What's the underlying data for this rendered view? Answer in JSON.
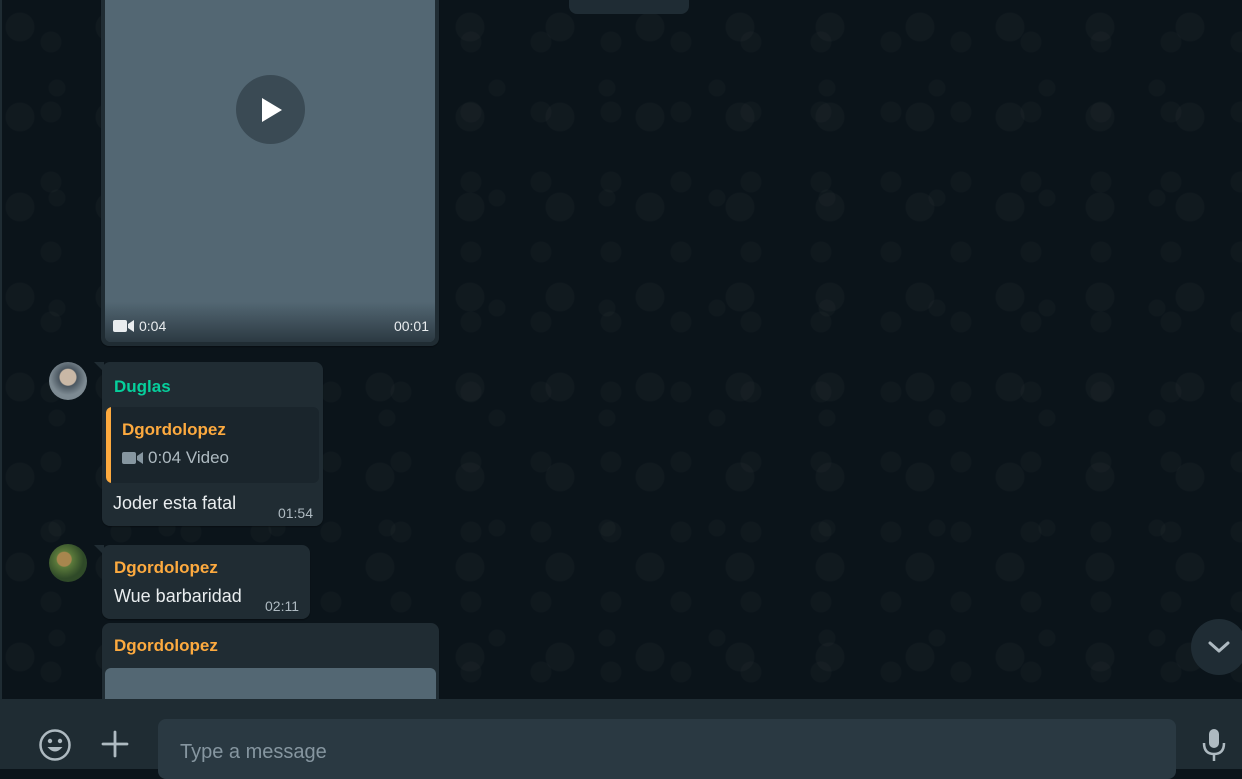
{
  "colors": {
    "background": "#0b141a",
    "bubble": "#202c33",
    "footer": "#1f2c33",
    "input": "#2a3942",
    "sender_green": "#06cf9c",
    "sender_orange": "#fdaa3f",
    "video_thumb": "#536773"
  },
  "messages": {
    "video": {
      "duration": "0:04",
      "time": "00:01",
      "play_icon": "play-icon",
      "video_icon": "video-camera-icon"
    },
    "duglas": {
      "sender": "Duglas",
      "quote": {
        "sender": "Dgordolopez",
        "duration": "0:04",
        "type": "Video"
      },
      "text": "Joder esta fatal",
      "time": "01:54"
    },
    "wue": {
      "sender": "Dgordolopez",
      "text": "Wue barbaridad",
      "time": "02:11"
    },
    "last": {
      "sender": "Dgordolopez"
    }
  },
  "footer": {
    "input_placeholder": "Type a message",
    "input_value": "",
    "icons": [
      "emoji-icon",
      "plus-icon",
      "microphone-icon"
    ]
  },
  "scroll_down_icon": "chevron-down-icon"
}
